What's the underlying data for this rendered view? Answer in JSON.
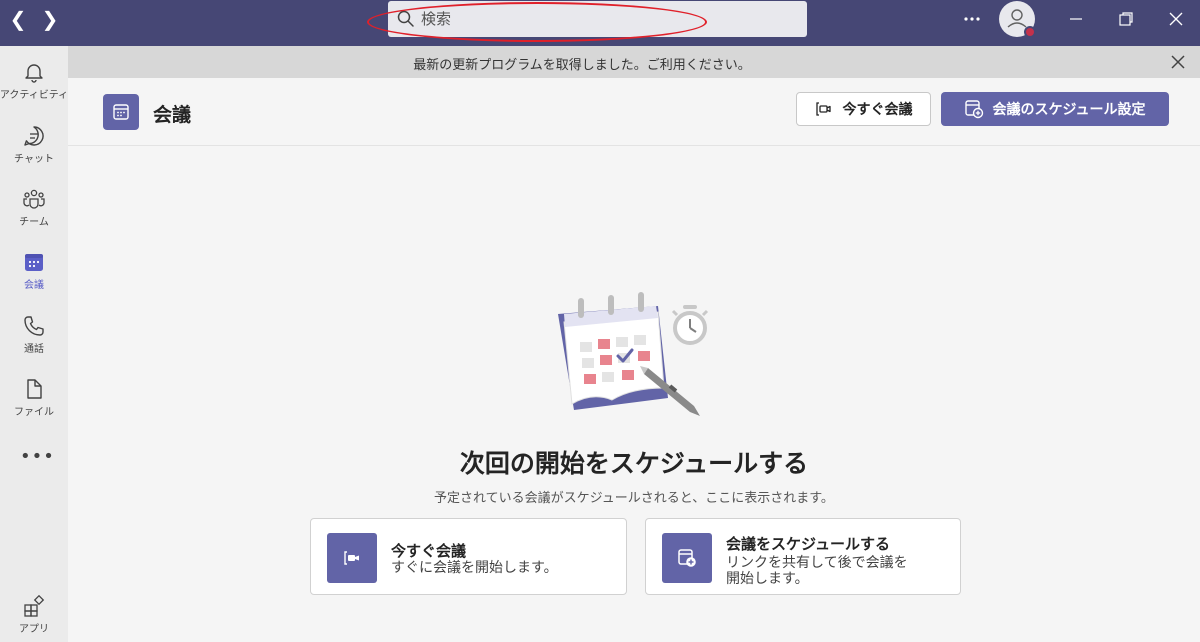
{
  "search": {
    "placeholder": "検索"
  },
  "banner": {
    "text": "最新の更新プログラムを取得しました。ご利用ください。"
  },
  "rail": {
    "items": [
      {
        "label": "アクティビティ",
        "icon": "bell-icon"
      },
      {
        "label": "チャット",
        "icon": "chat-icon"
      },
      {
        "label": "チーム",
        "icon": "teams-icon"
      },
      {
        "label": "会議",
        "icon": "calendar-icon"
      },
      {
        "label": "通話",
        "icon": "phone-icon"
      },
      {
        "label": "ファイル",
        "icon": "file-icon"
      }
    ],
    "more": "•••",
    "apps_label": "アプリ"
  },
  "header": {
    "title": "会議",
    "meet_now_label": "今すぐ会議",
    "schedule_label": "会議のスケジュール設定"
  },
  "empty_state": {
    "title": "次回の開始をスケジュールする",
    "subtitle": "予定されている会議がスケジュールされると、ここに表示されます。"
  },
  "cards": [
    {
      "title": "今すぐ会議",
      "desc_line1": "すぐに会議を開始します。",
      "desc_line2": ""
    },
    {
      "title": "会議をスケジュールする",
      "desc_line1": "リンクを共有して後で会議を",
      "desc_line2": "開始します。"
    }
  ],
  "colors": {
    "titlebar": "#464775",
    "accent": "#6264a7",
    "status_busy": "#c4314b",
    "annotation": "#e0202a"
  }
}
